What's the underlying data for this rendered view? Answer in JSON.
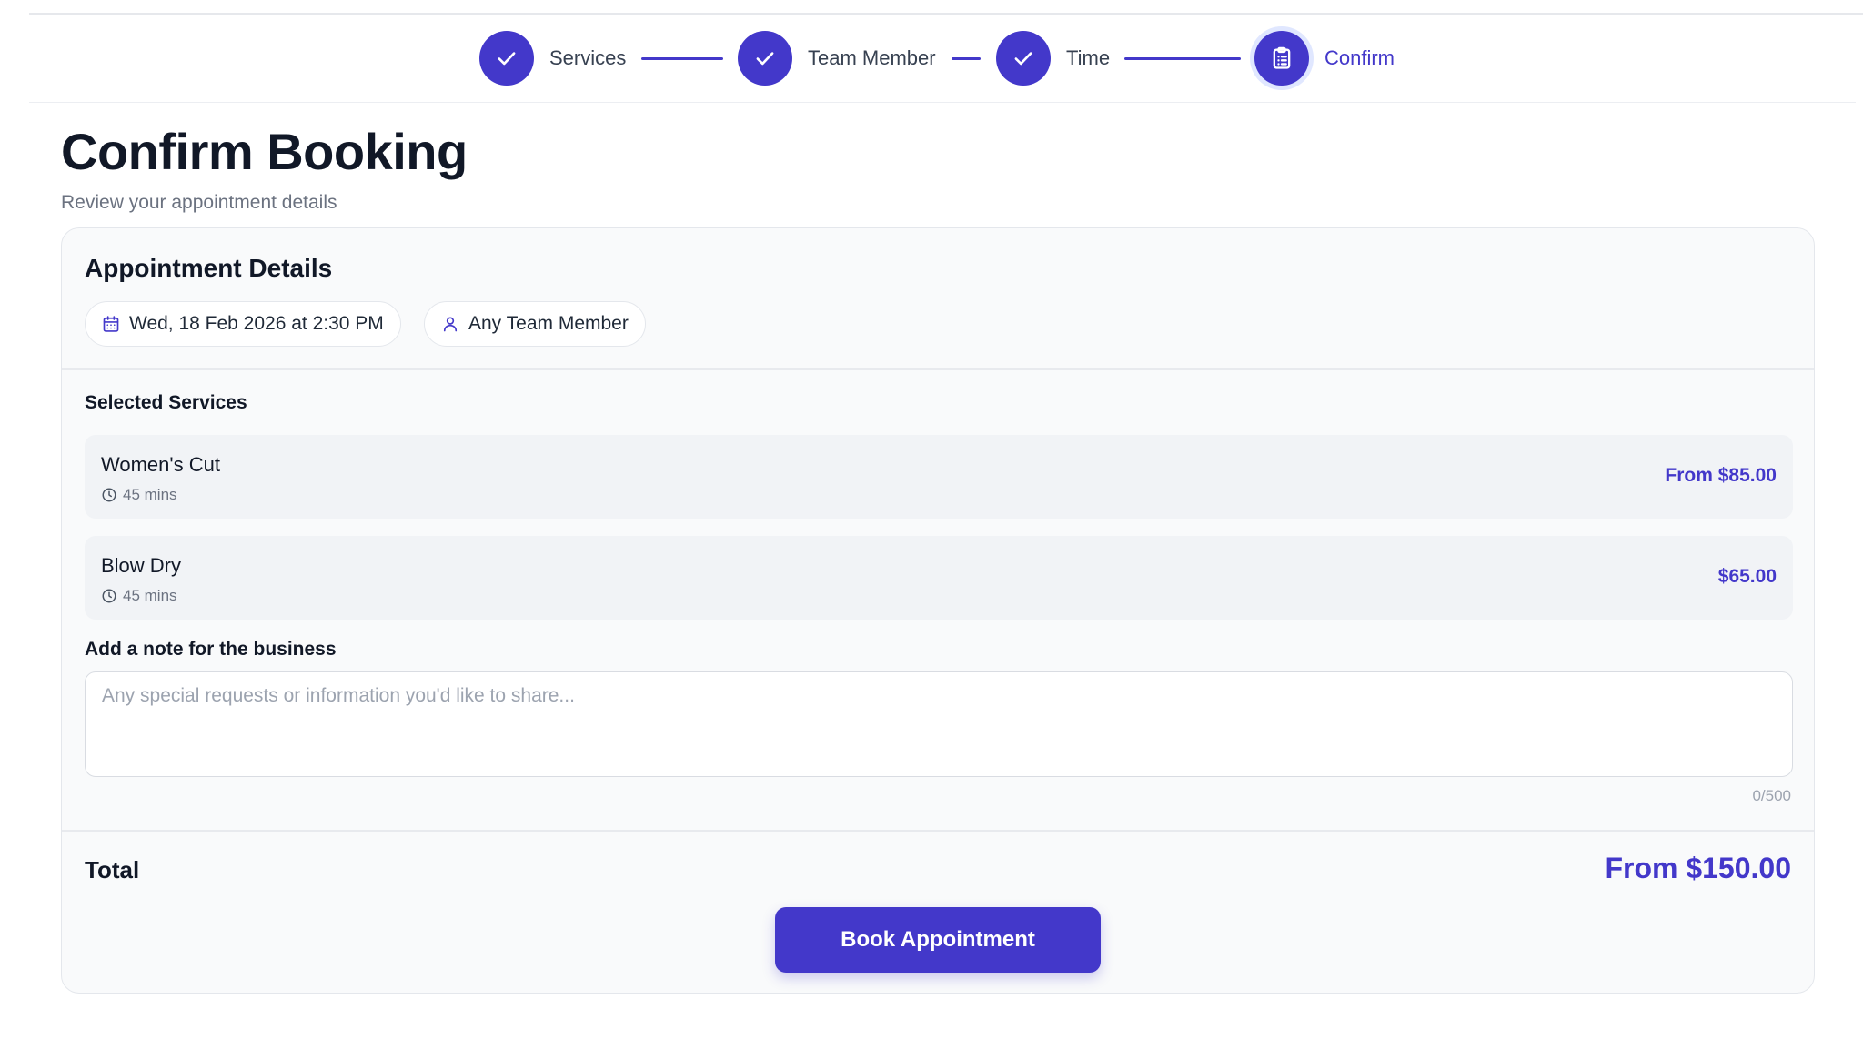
{
  "colors": {
    "accent": "#4338ca",
    "text_primary": "#111827",
    "text_muted": "#6b7280",
    "placeholder": "#9ca3af",
    "border": "#e4e7ec",
    "row_background": "#f1f3f6"
  },
  "stepper": {
    "steps": [
      {
        "label": "Services",
        "status": "completed",
        "icon": "check-icon"
      },
      {
        "label": "Team Member",
        "status": "completed",
        "icon": "check-icon"
      },
      {
        "label": "Time",
        "status": "completed",
        "icon": "check-icon"
      },
      {
        "label": "Confirm",
        "status": "current",
        "icon": "clipboard-list-icon"
      }
    ]
  },
  "page": {
    "title": "Confirm Booking",
    "subtitle": "Review your appointment details"
  },
  "appointment": {
    "heading": "Appointment Details",
    "datetime": "Wed, 18 Feb 2026 at 2:30 PM",
    "datetime_icon": "calendar-icon",
    "team_member": "Any Team Member",
    "team_member_icon": "user-icon"
  },
  "services": {
    "heading": "Selected Services",
    "items": [
      {
        "name": "Women's Cut",
        "duration": "45 mins",
        "price": "From $85.00"
      },
      {
        "name": "Blow Dry",
        "duration": "45 mins",
        "price": "$65.00"
      }
    ]
  },
  "note": {
    "label": "Add a note for the business",
    "placeholder": "Any special requests or information you'd like to share...",
    "value": "",
    "char_count": "0/500"
  },
  "total": {
    "label": "Total",
    "value": "From $150.00"
  },
  "actions": {
    "book_label": "Book Appointment"
  }
}
